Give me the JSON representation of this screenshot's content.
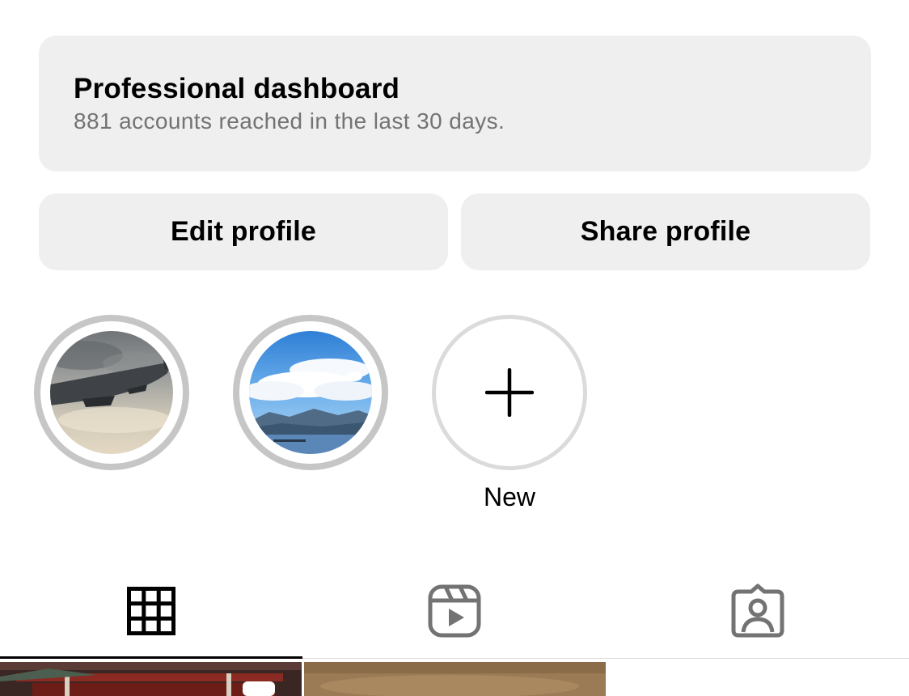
{
  "dashboard": {
    "title": "Professional dashboard",
    "subtitle": "881 accounts reached in the last 30 days."
  },
  "actions": {
    "edit_label": "Edit profile",
    "share_label": "Share profile"
  },
  "highlights": {
    "items": [
      {
        "thumbnail": "airplane-wing-photo"
      },
      {
        "thumbnail": "sky-mountain-lake-photo"
      }
    ],
    "new_label": "New"
  },
  "tabs": [
    {
      "icon": "grid-icon",
      "selected": true
    },
    {
      "icon": "reels-icon",
      "selected": false
    },
    {
      "icon": "tagged-icon",
      "selected": false
    }
  ],
  "colors": {
    "card_bg": "#efefef",
    "subtitle_text": "#737373",
    "ring": "#c6c6c6",
    "inactive_icon": "#737373"
  }
}
